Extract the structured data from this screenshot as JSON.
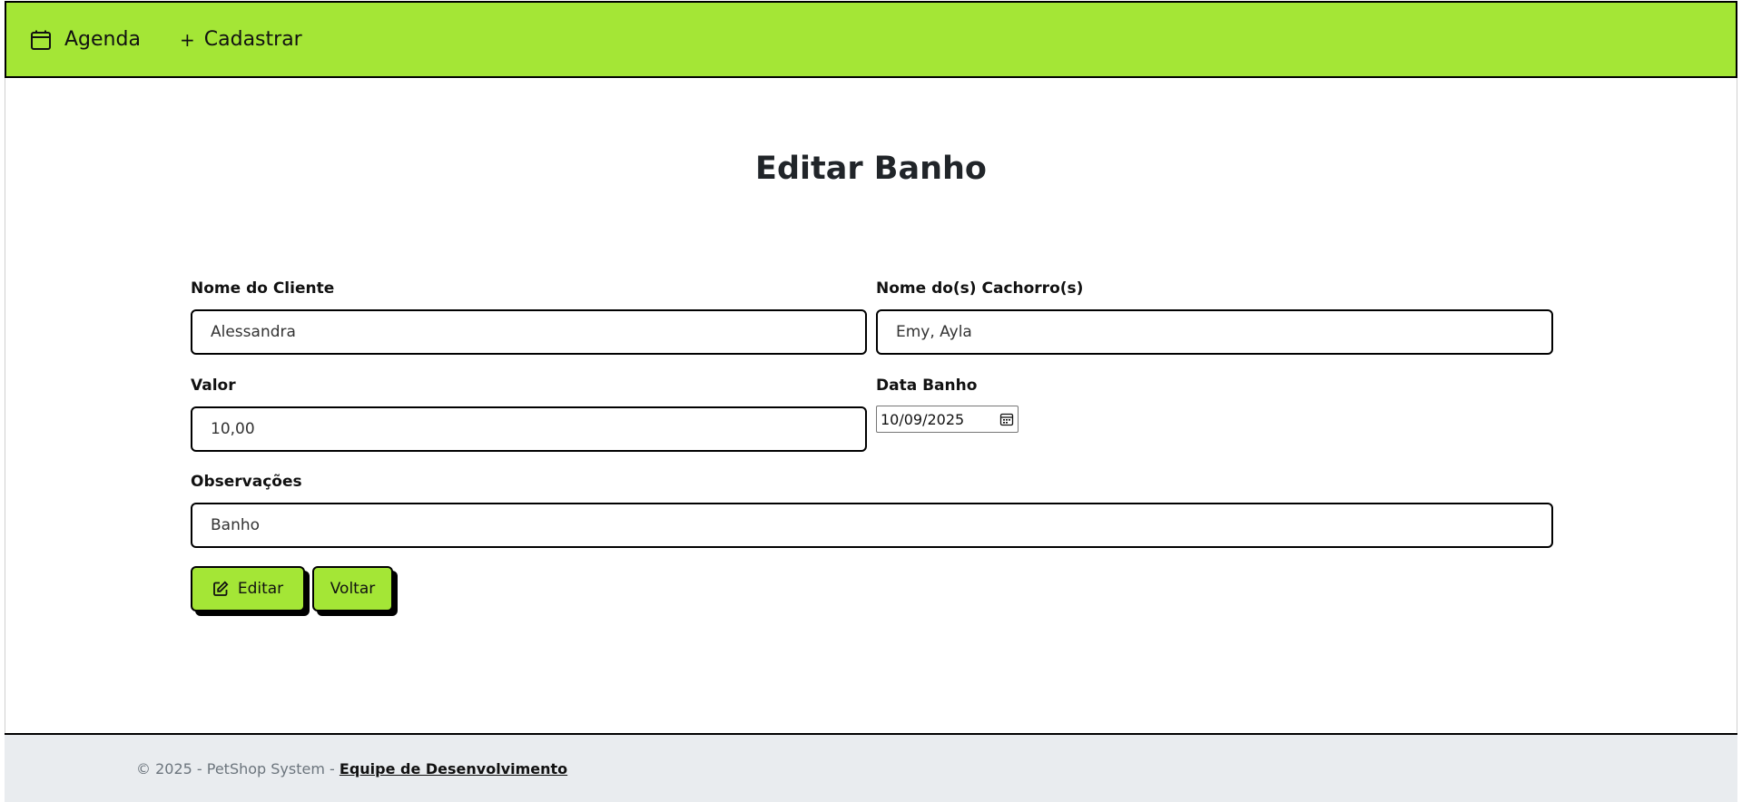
{
  "navbar": {
    "agenda_label": "Agenda",
    "cadastrar_label": "Cadastrar",
    "cadastrar_prefix": "+",
    "background": "#a4e636"
  },
  "page": {
    "title": "Editar Banho"
  },
  "form": {
    "cliente": {
      "label": "Nome do Cliente",
      "value": "Alessandra"
    },
    "cachorros": {
      "label": "Nome do(s) Cachorro(s)",
      "value": "Emy, Ayla"
    },
    "valor": {
      "label": "Valor",
      "value": "10,00"
    },
    "data": {
      "label": "Data Banho",
      "value": "10/09/2025"
    },
    "observacoes": {
      "label": "Observações",
      "value": "Banho"
    }
  },
  "buttons": {
    "editar_label": "Editar",
    "voltar_label": "Voltar"
  },
  "footer": {
    "text": "© 2025 - PetShop System - ",
    "link_label": "Equipe de Desenvolvimento",
    "background": "#e9ecef"
  },
  "icons": {
    "agenda": "calendar-icon",
    "cadastrar": "plus-icon",
    "editar": "edit-icon",
    "date_picker": "calendar-small-icon"
  }
}
